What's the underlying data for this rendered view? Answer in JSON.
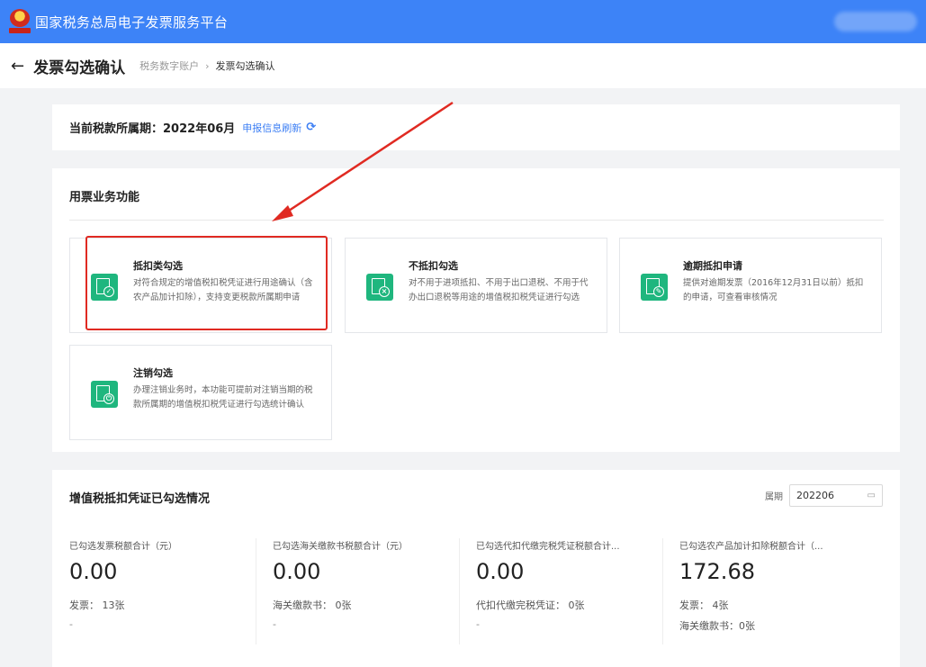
{
  "topbar": {
    "title": "国家税务总局电子发票服务平台"
  },
  "header": {
    "title": "发票勾选确认",
    "breadcrumb": [
      "税务数字账户",
      "发票勾选确认"
    ]
  },
  "period_bar": {
    "label": "当前税款所属期：",
    "value": "2022年06月",
    "refresh": "申报信息刷新"
  },
  "functions": {
    "title": "用票业务功能",
    "cards": [
      {
        "title": "抵扣类勾选",
        "desc": "对符合规定的增值税扣税凭证进行用途确认（含农产品加计扣除），支持变更税款所属期申请",
        "icon": "check-document-icon"
      },
      {
        "title": "不抵扣勾选",
        "desc": "对不用于进项抵扣、不用于出口退税、不用于代办出口退税等用途的增值税扣税凭证进行勾选",
        "icon": "cross-document-icon"
      },
      {
        "title": "逾期抵扣申请",
        "desc": "提供对逾期发票（2016年12月31日以前）抵扣的申请，可查看审核情况",
        "icon": "edit-document-icon"
      },
      {
        "title": "注销勾选",
        "desc": "办理注销业务时，本功能可提前对注销当期的税款所属期的增值税扣税凭证进行勾选统计确认",
        "icon": "power-document-icon"
      }
    ]
  },
  "summary": {
    "title": "增值税抵扣凭证已勾选情况",
    "period_label": "属期",
    "period_value": "202206",
    "stats": [
      {
        "label": "已勾选发票税额合计（元）",
        "value": "0.00",
        "detail1": "发票： 13张",
        "detail2": "-"
      },
      {
        "label": "已勾选海关缴款书税额合计（元）",
        "value": "0.00",
        "detail1": "海关缴款书： 0张",
        "detail2": "-"
      },
      {
        "label": "已勾选代扣代缴完税凭证税额合计...",
        "value": "0.00",
        "detail1": "代扣代缴完税凭证： 0张",
        "detail2": "-"
      },
      {
        "label": "已勾选农产品加计扣除税额合计（...",
        "value": "172.68",
        "detail1": "发票： 4张",
        "detail2": "海关缴款书：0张"
      }
    ]
  },
  "colors": {
    "topbar": "#3d83f7",
    "accent_green": "#1fb67e",
    "highlight_red": "#e02a22",
    "link_blue": "#3d7ff4"
  }
}
